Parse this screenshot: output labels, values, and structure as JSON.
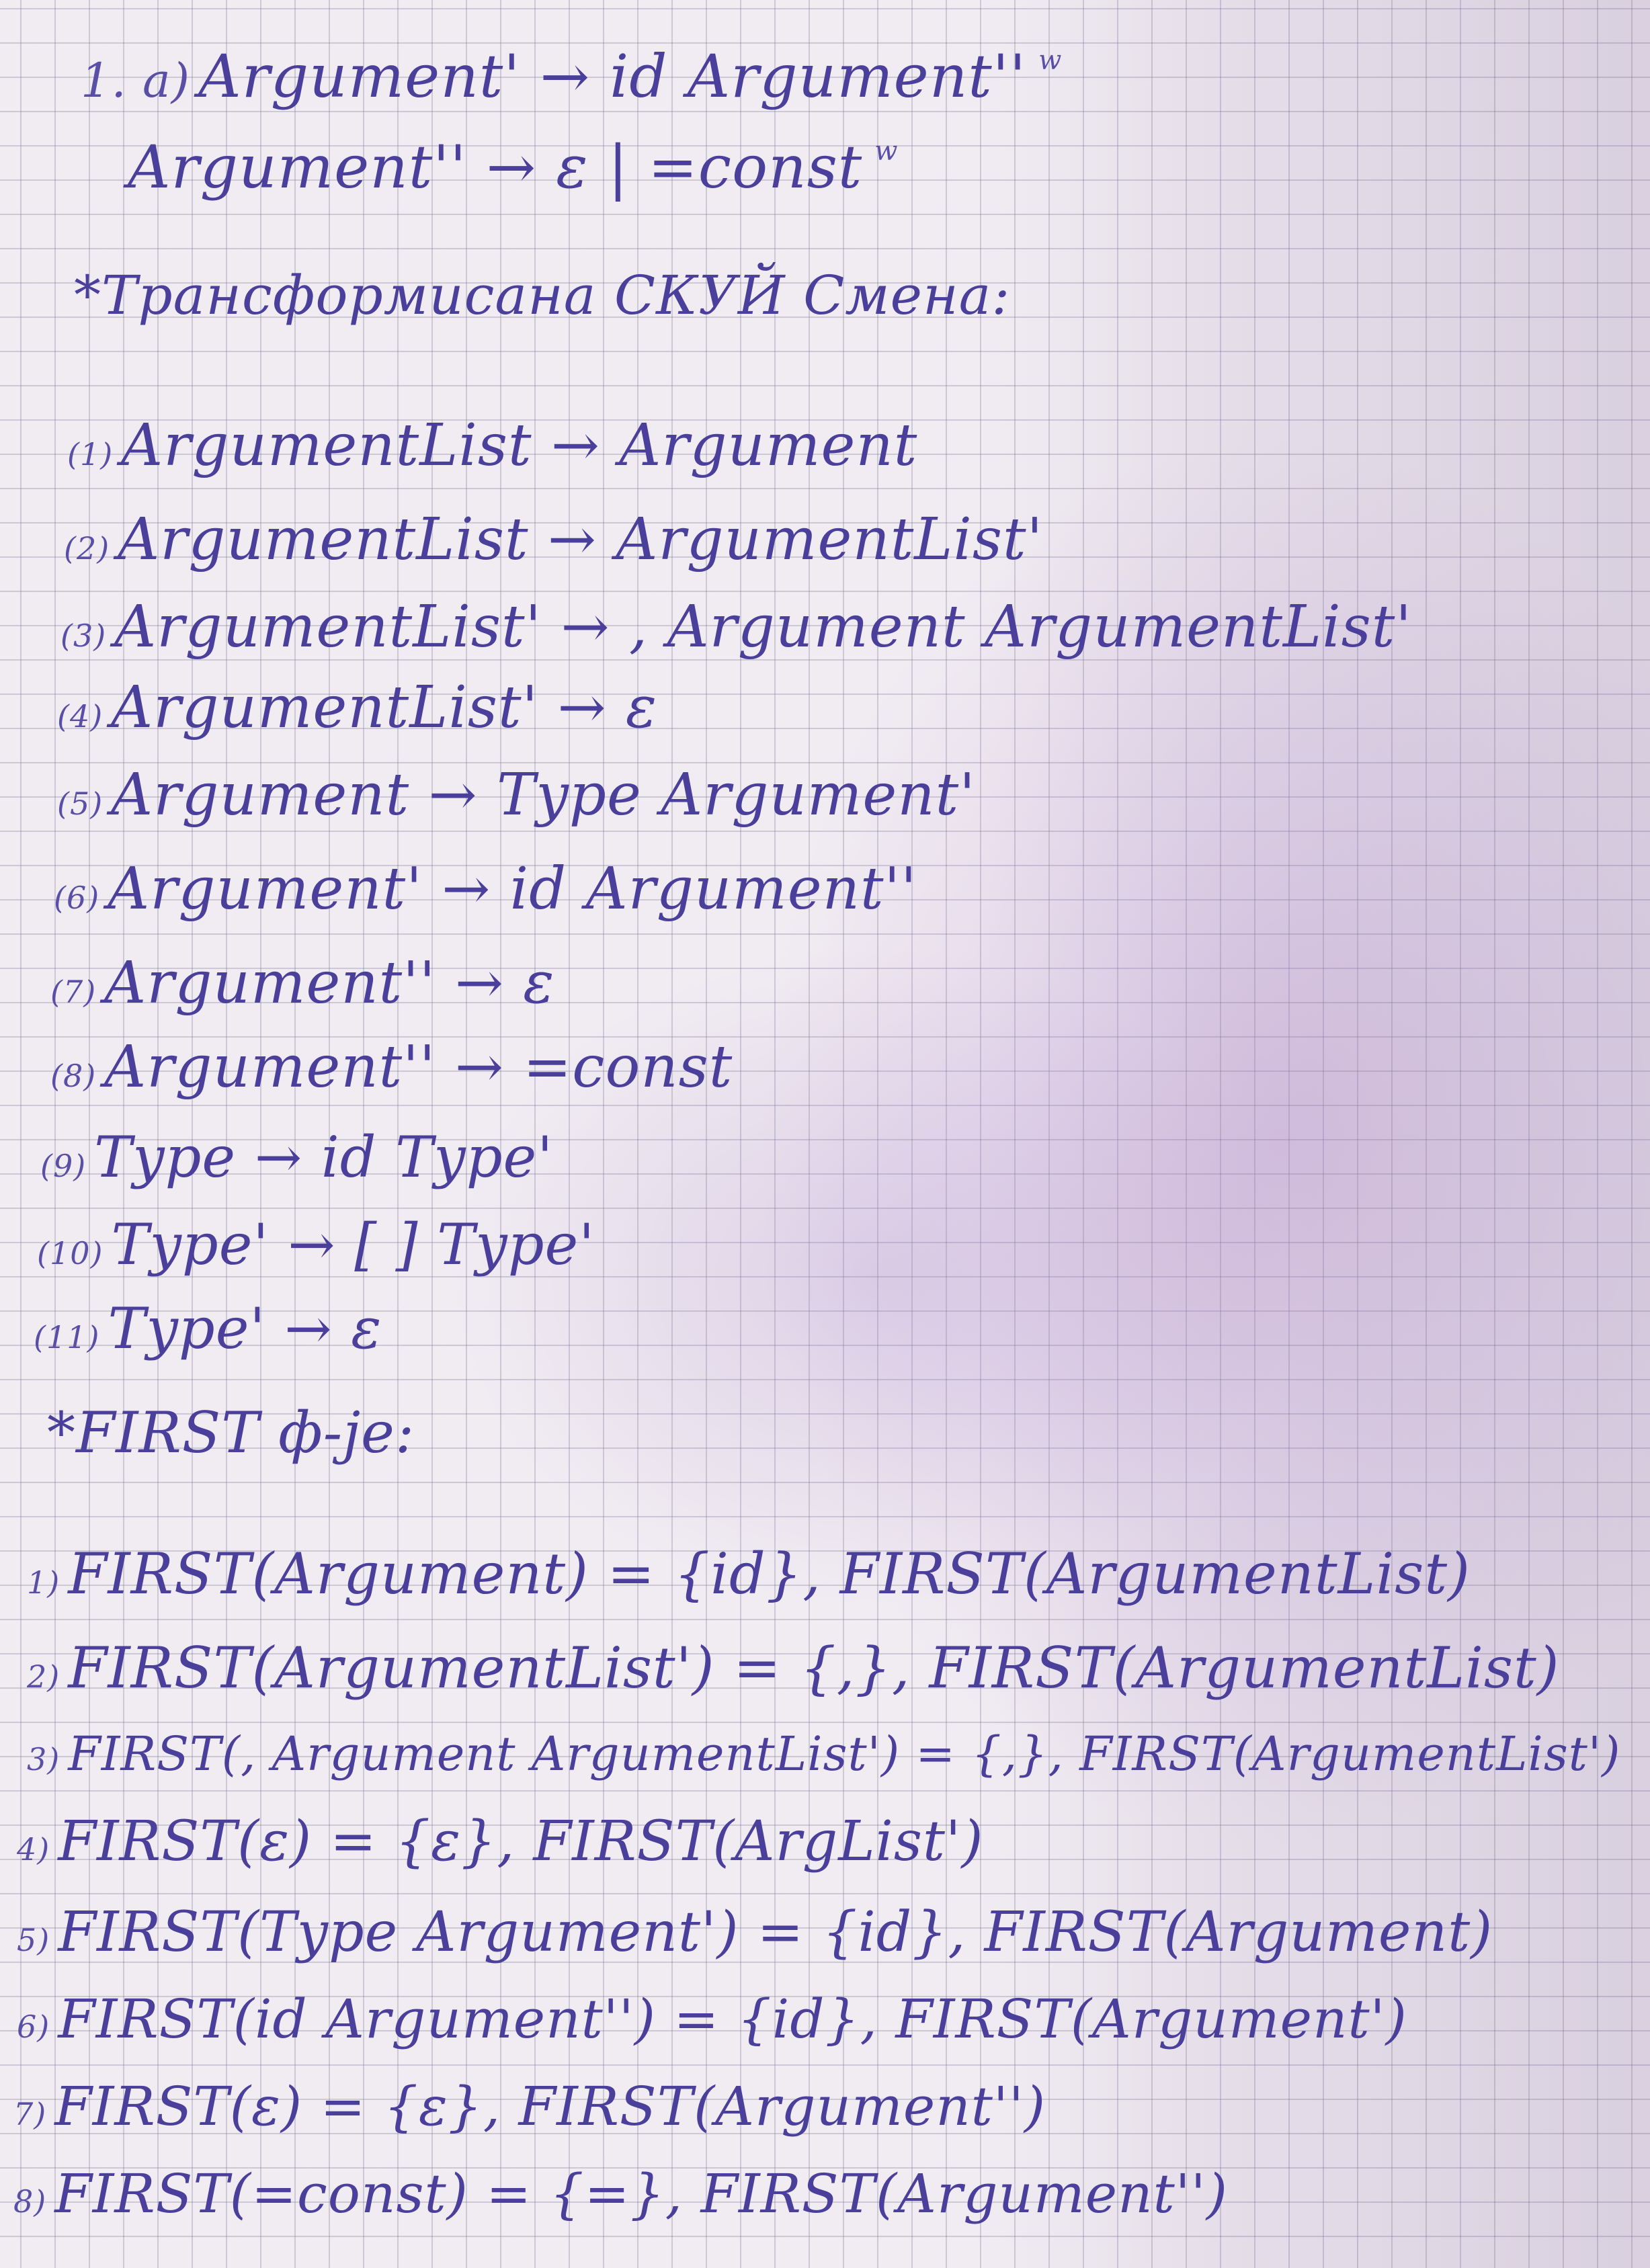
{
  "header": {
    "label": "1. a)",
    "line1": "Argument' → id Argument''",
    "line2": "Argument'' → ε | =const",
    "check_mark": "w"
  },
  "section_rules": {
    "title": "*Трансформисана СКУЙ Смена:",
    "rules": [
      {
        "num": "(1)",
        "text": "ArgumentList → Argument"
      },
      {
        "num": "(2)",
        "text": "ArgumentList → ArgumentList'"
      },
      {
        "num": "(3)",
        "text": "ArgumentList' → , Argument ArgumentList'"
      },
      {
        "num": "(4)",
        "text": "ArgumentList' → ε"
      },
      {
        "num": "(5)",
        "text": "Argument → Type Argument'"
      },
      {
        "num": "(6)",
        "text": "Argument' → id Argument''"
      },
      {
        "num": "(7)",
        "text": "Argument'' → ε"
      },
      {
        "num": "(8)",
        "text": "Argument'' → =const"
      },
      {
        "num": "(9)",
        "text": "Type → id Type'"
      },
      {
        "num": "(10)",
        "text": "Type' → [ ] Type'"
      },
      {
        "num": "(11)",
        "text": "Type' → ε"
      }
    ]
  },
  "section_first": {
    "title": "*FIRST ф-је:",
    "items": [
      {
        "num": "1)",
        "text": "FIRST(Argument) = {id}, FIRST(ArgumentList)"
      },
      {
        "num": "2)",
        "text": "FIRST(ArgumentList') = {,}, FIRST(ArgumentList)"
      },
      {
        "num": "3)",
        "text": "FIRST(, Argument ArgumentList') = {,}, FIRST(ArgumentList')"
      },
      {
        "num": "4)",
        "text": "FIRST(ε) = {ε}, FIRST(ArgList')"
      },
      {
        "num": "5)",
        "text": "FIRST(Type Argument') = {id}, FIRST(Argument)"
      },
      {
        "num": "6)",
        "text": "FIRST(id Argument'') = {id}, FIRST(Argument')"
      },
      {
        "num": "7)",
        "text": "FIRST(ε) = {ε}, FIRST(Argument'')"
      },
      {
        "num": "8)",
        "text": "FIRST(=const) = {=}, FIRST(Argument'')"
      }
    ]
  }
}
